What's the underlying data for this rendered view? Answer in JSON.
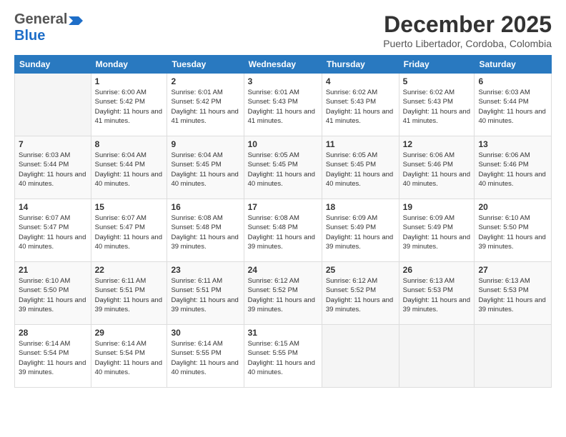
{
  "header": {
    "logo_general": "General",
    "logo_blue": "Blue",
    "month_title": "December 2025",
    "location": "Puerto Libertador, Cordoba, Colombia"
  },
  "days_of_week": [
    "Sunday",
    "Monday",
    "Tuesday",
    "Wednesday",
    "Thursday",
    "Friday",
    "Saturday"
  ],
  "weeks": [
    [
      {
        "day": "",
        "sunrise": "",
        "sunset": "",
        "daylight": ""
      },
      {
        "day": "1",
        "sunrise": "Sunrise: 6:00 AM",
        "sunset": "Sunset: 5:42 PM",
        "daylight": "Daylight: 11 hours and 41 minutes."
      },
      {
        "day": "2",
        "sunrise": "Sunrise: 6:01 AM",
        "sunset": "Sunset: 5:42 PM",
        "daylight": "Daylight: 11 hours and 41 minutes."
      },
      {
        "day": "3",
        "sunrise": "Sunrise: 6:01 AM",
        "sunset": "Sunset: 5:43 PM",
        "daylight": "Daylight: 11 hours and 41 minutes."
      },
      {
        "day": "4",
        "sunrise": "Sunrise: 6:02 AM",
        "sunset": "Sunset: 5:43 PM",
        "daylight": "Daylight: 11 hours and 41 minutes."
      },
      {
        "day": "5",
        "sunrise": "Sunrise: 6:02 AM",
        "sunset": "Sunset: 5:43 PM",
        "daylight": "Daylight: 11 hours and 41 minutes."
      },
      {
        "day": "6",
        "sunrise": "Sunrise: 6:03 AM",
        "sunset": "Sunset: 5:44 PM",
        "daylight": "Daylight: 11 hours and 40 minutes."
      }
    ],
    [
      {
        "day": "7",
        "sunrise": "Sunrise: 6:03 AM",
        "sunset": "Sunset: 5:44 PM",
        "daylight": "Daylight: 11 hours and 40 minutes."
      },
      {
        "day": "8",
        "sunrise": "Sunrise: 6:04 AM",
        "sunset": "Sunset: 5:44 PM",
        "daylight": "Daylight: 11 hours and 40 minutes."
      },
      {
        "day": "9",
        "sunrise": "Sunrise: 6:04 AM",
        "sunset": "Sunset: 5:45 PM",
        "daylight": "Daylight: 11 hours and 40 minutes."
      },
      {
        "day": "10",
        "sunrise": "Sunrise: 6:05 AM",
        "sunset": "Sunset: 5:45 PM",
        "daylight": "Daylight: 11 hours and 40 minutes."
      },
      {
        "day": "11",
        "sunrise": "Sunrise: 6:05 AM",
        "sunset": "Sunset: 5:45 PM",
        "daylight": "Daylight: 11 hours and 40 minutes."
      },
      {
        "day": "12",
        "sunrise": "Sunrise: 6:06 AM",
        "sunset": "Sunset: 5:46 PM",
        "daylight": "Daylight: 11 hours and 40 minutes."
      },
      {
        "day": "13",
        "sunrise": "Sunrise: 6:06 AM",
        "sunset": "Sunset: 5:46 PM",
        "daylight": "Daylight: 11 hours and 40 minutes."
      }
    ],
    [
      {
        "day": "14",
        "sunrise": "Sunrise: 6:07 AM",
        "sunset": "Sunset: 5:47 PM",
        "daylight": "Daylight: 11 hours and 40 minutes."
      },
      {
        "day": "15",
        "sunrise": "Sunrise: 6:07 AM",
        "sunset": "Sunset: 5:47 PM",
        "daylight": "Daylight: 11 hours and 40 minutes."
      },
      {
        "day": "16",
        "sunrise": "Sunrise: 6:08 AM",
        "sunset": "Sunset: 5:48 PM",
        "daylight": "Daylight: 11 hours and 39 minutes."
      },
      {
        "day": "17",
        "sunrise": "Sunrise: 6:08 AM",
        "sunset": "Sunset: 5:48 PM",
        "daylight": "Daylight: 11 hours and 39 minutes."
      },
      {
        "day": "18",
        "sunrise": "Sunrise: 6:09 AM",
        "sunset": "Sunset: 5:49 PM",
        "daylight": "Daylight: 11 hours and 39 minutes."
      },
      {
        "day": "19",
        "sunrise": "Sunrise: 6:09 AM",
        "sunset": "Sunset: 5:49 PM",
        "daylight": "Daylight: 11 hours and 39 minutes."
      },
      {
        "day": "20",
        "sunrise": "Sunrise: 6:10 AM",
        "sunset": "Sunset: 5:50 PM",
        "daylight": "Daylight: 11 hours and 39 minutes."
      }
    ],
    [
      {
        "day": "21",
        "sunrise": "Sunrise: 6:10 AM",
        "sunset": "Sunset: 5:50 PM",
        "daylight": "Daylight: 11 hours and 39 minutes."
      },
      {
        "day": "22",
        "sunrise": "Sunrise: 6:11 AM",
        "sunset": "Sunset: 5:51 PM",
        "daylight": "Daylight: 11 hours and 39 minutes."
      },
      {
        "day": "23",
        "sunrise": "Sunrise: 6:11 AM",
        "sunset": "Sunset: 5:51 PM",
        "daylight": "Daylight: 11 hours and 39 minutes."
      },
      {
        "day": "24",
        "sunrise": "Sunrise: 6:12 AM",
        "sunset": "Sunset: 5:52 PM",
        "daylight": "Daylight: 11 hours and 39 minutes."
      },
      {
        "day": "25",
        "sunrise": "Sunrise: 6:12 AM",
        "sunset": "Sunset: 5:52 PM",
        "daylight": "Daylight: 11 hours and 39 minutes."
      },
      {
        "day": "26",
        "sunrise": "Sunrise: 6:13 AM",
        "sunset": "Sunset: 5:53 PM",
        "daylight": "Daylight: 11 hours and 39 minutes."
      },
      {
        "day": "27",
        "sunrise": "Sunrise: 6:13 AM",
        "sunset": "Sunset: 5:53 PM",
        "daylight": "Daylight: 11 hours and 39 minutes."
      }
    ],
    [
      {
        "day": "28",
        "sunrise": "Sunrise: 6:14 AM",
        "sunset": "Sunset: 5:54 PM",
        "daylight": "Daylight: 11 hours and 39 minutes."
      },
      {
        "day": "29",
        "sunrise": "Sunrise: 6:14 AM",
        "sunset": "Sunset: 5:54 PM",
        "daylight": "Daylight: 11 hours and 40 minutes."
      },
      {
        "day": "30",
        "sunrise": "Sunrise: 6:14 AM",
        "sunset": "Sunset: 5:55 PM",
        "daylight": "Daylight: 11 hours and 40 minutes."
      },
      {
        "day": "31",
        "sunrise": "Sunrise: 6:15 AM",
        "sunset": "Sunset: 5:55 PM",
        "daylight": "Daylight: 11 hours and 40 minutes."
      },
      {
        "day": "",
        "sunrise": "",
        "sunset": "",
        "daylight": ""
      },
      {
        "day": "",
        "sunrise": "",
        "sunset": "",
        "daylight": ""
      },
      {
        "day": "",
        "sunrise": "",
        "sunset": "",
        "daylight": ""
      }
    ]
  ]
}
